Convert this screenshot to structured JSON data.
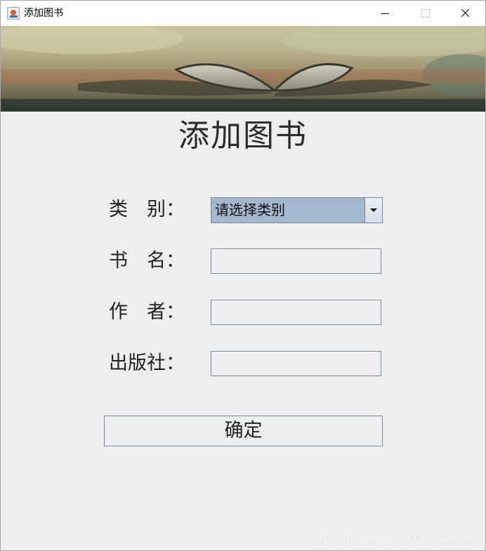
{
  "window": {
    "title": "添加图书",
    "icon": "java-icon"
  },
  "heading": "添加图书",
  "form": {
    "category_label": "类　别：",
    "category_selected": "请选择类别",
    "name_label": "书　名：",
    "name_value": "",
    "author_label": "作　者：",
    "author_value": "",
    "publisher_label": "出版社：",
    "publisher_value": ""
  },
  "submit_label": "确定",
  "watermark": "https://blog.csdn.net/kongsanjin"
}
